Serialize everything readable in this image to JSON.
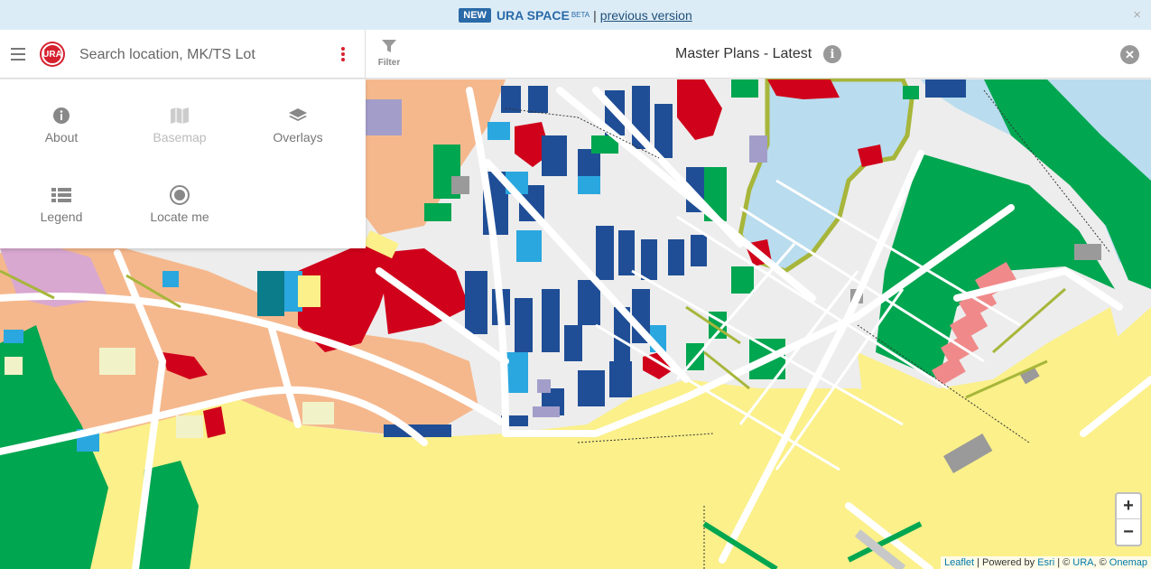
{
  "banner": {
    "badge": "NEW",
    "brand": "URA SPACE",
    "beta": "BETA",
    "separator": "|",
    "link": "previous version",
    "close_glyph": "×"
  },
  "header": {
    "logo_text": "URA",
    "search_placeholder": "Search location, MK/TS Lot",
    "filter_label": "Filter",
    "title": "Master Plans - Latest",
    "info_glyph": "i",
    "close_glyph": "✕"
  },
  "menu": {
    "items": [
      {
        "label": "About",
        "icon": "info-icon",
        "enabled": true
      },
      {
        "label": "Basemap",
        "icon": "map-icon",
        "enabled": false
      },
      {
        "label": "Overlays",
        "icon": "layers-icon",
        "enabled": true
      },
      {
        "label": "Legend",
        "icon": "list-icon",
        "enabled": true
      },
      {
        "label": "Locate me",
        "icon": "target-icon",
        "enabled": true
      }
    ]
  },
  "zoom": {
    "in": "+",
    "out": "−"
  },
  "attribution": {
    "leaflet": "Leaflet",
    "powered": " | Powered by ",
    "esri": "Esri",
    "copy": " | © ",
    "ura": "URA",
    "copy2": ", © ",
    "onemap": "Onemap"
  },
  "colors": {
    "accent": "#d5202e",
    "banner_bg": "#dcecf6",
    "residential": "#f5b88d",
    "commercial": "#1f4e96",
    "business_red": "#d0021b",
    "park": "#00a650",
    "water": "#b9dcee",
    "reserve": "#fbf08a",
    "civic": "#a39ec9",
    "road": "#ffffff",
    "white_site": "#f2f2f2"
  }
}
